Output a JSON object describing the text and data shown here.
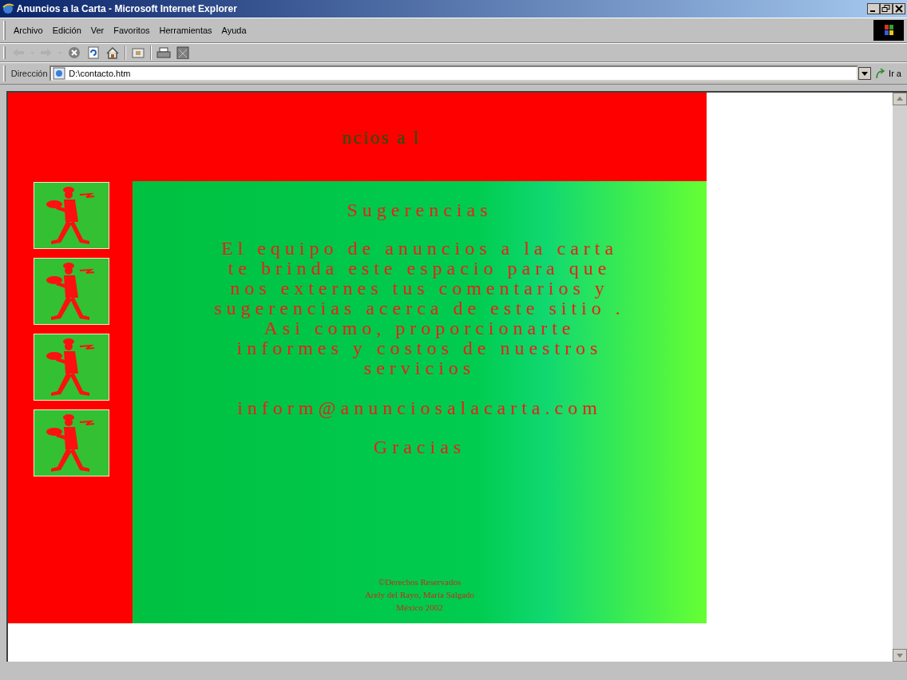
{
  "window": {
    "title": "Anuncios a la Carta - Microsoft Internet Explorer"
  },
  "menu": [
    "Archivo",
    "Edición",
    "Ver",
    "Favoritos",
    "Herramientas",
    "Ayuda"
  ],
  "toolbar": [
    {
      "kind": "back",
      "disabled": true
    },
    {
      "kind": "dropdown",
      "disabled": true
    },
    {
      "kind": "forward",
      "disabled": true
    },
    {
      "kind": "dropdown",
      "disabled": true
    },
    {
      "kind": "stop"
    },
    {
      "kind": "refresh"
    },
    {
      "kind": "home"
    },
    {
      "kind": "separator"
    },
    {
      "kind": "folder"
    },
    {
      "kind": "separator"
    },
    {
      "kind": "print"
    },
    {
      "kind": "edit"
    }
  ],
  "address_bar": {
    "label": "Dirección",
    "value": "D:\\contacto.htm",
    "go_button": "Ir a"
  },
  "page": {
    "banner_text": "ncios a l",
    "sidebar_images": [
      {
        "kind": "waiter"
      },
      {
        "kind": "waiter"
      },
      {
        "kind": "waiter"
      },
      {
        "kind": "waiter"
      }
    ],
    "heading": "Sugerencias",
    "message_lines": [
      "El equipo de anuncios a la carta",
      "te brinda este espacio para que",
      "nos externes tus comentarios y",
      "sugerencias acerca de este sitio .",
      "Asi como, proporcionarte",
      "informes y costos de nuestros",
      "servicios"
    ],
    "email": "inform@anunciosalacarta.com",
    "thanks": "Gracias",
    "footer_lines": [
      "©Derechos Reservados",
      "Arely del Rayo, Maria Salgado",
      "México 2002"
    ]
  }
}
